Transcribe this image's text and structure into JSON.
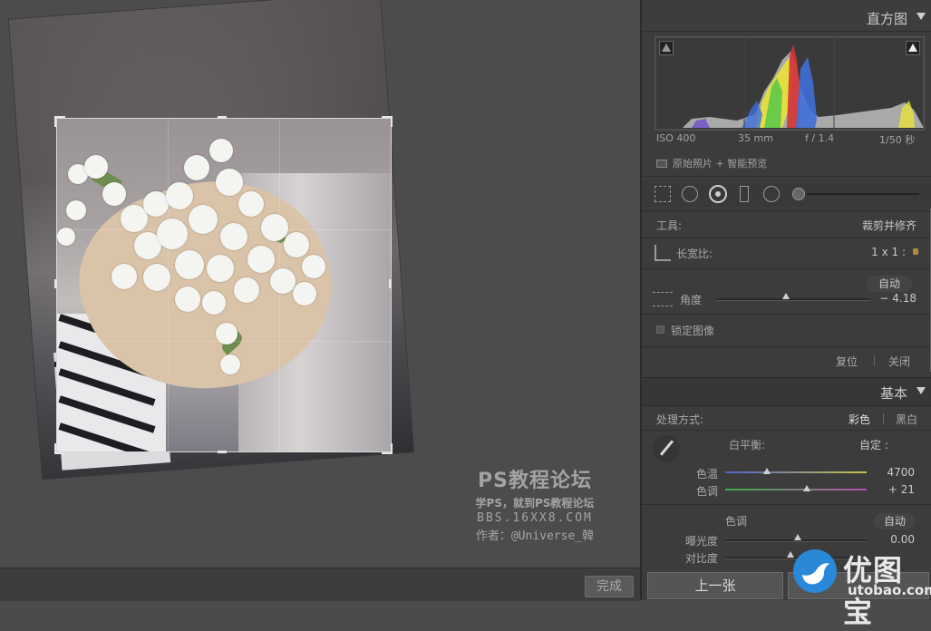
{
  "panel": {
    "histogram": {
      "title": "直方图",
      "iso": "ISO 400",
      "focal": "35 mm",
      "aperture": "f / 1.4",
      "shutter": "1/50 秒",
      "preview_mode": "原始照片 + 智能预览"
    },
    "crop": {
      "tool_label": "工具:",
      "tool_value": "裁剪并修齐",
      "aspect_label": "长宽比:",
      "aspect_value": "1 x 1 :",
      "auto_label": "自动",
      "angle_label": "角度",
      "angle_value": "− 4.18",
      "angle_level": -4.18,
      "constrain_label": "锁定图像",
      "reset_label": "复位",
      "close_label": "关闭"
    },
    "basic": {
      "title": "基本",
      "treatment_label": "处理方式:",
      "color_option": "彩色",
      "bw_option": "黑白",
      "wb_label": "白平衡:",
      "wb_value": "自定 :",
      "temp_label": "色温",
      "temp_value": "4700",
      "tint_label": "色调",
      "tint_value": "+ 21",
      "tone_label": "色调",
      "tone_auto": "自动",
      "exposure_label": "曝光度",
      "exposure_value": "0.00",
      "contrast_label": "对比度"
    }
  },
  "toolbar": {
    "done_label": "完成"
  },
  "navigation": {
    "prev_label": "上一张"
  },
  "watermark": {
    "title": "PS教程论坛",
    "subtitle": "学PS，就到PS教程论坛",
    "url": "BBS.16XX8.COM",
    "author": "作者：@Universe_韓"
  },
  "logo": {
    "text": "优图宝",
    "url": "utobao.com"
  },
  "colors": {
    "panel_bg": "#3c3c3c",
    "canvas_bg": "#4b4b4b",
    "logo_blue": "#2a88d8"
  }
}
